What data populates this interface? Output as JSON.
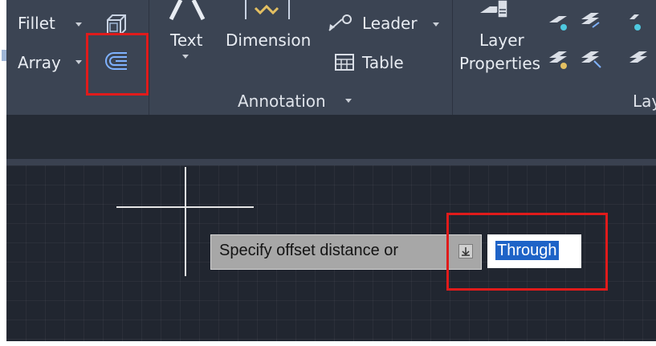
{
  "ribbon": {
    "modify": {
      "fillet_label": "Fillet",
      "array_label": "Array",
      "box_icon": "3d-box-icon",
      "offset_icon": "offset-icon"
    },
    "annotation": {
      "text_label": "Text",
      "dimension_label": "Dimension",
      "leader_label": "Leader",
      "table_label": "Table",
      "panel_label": "Annotation"
    },
    "layers": {
      "layer_properties_line1": "Layer",
      "layer_properties_line2": "Properties",
      "panel_label_partial": "Lay"
    }
  },
  "command_prompt": {
    "tooltip_text": "Specify offset distance or",
    "options_icon": "dropdown-options-icon",
    "input_value": "Through"
  },
  "colors": {
    "ribbon_bg": "#3b4453",
    "canvas_bg": "#212630",
    "highlight": "#e01b1b",
    "selection": "#1e63c7"
  }
}
